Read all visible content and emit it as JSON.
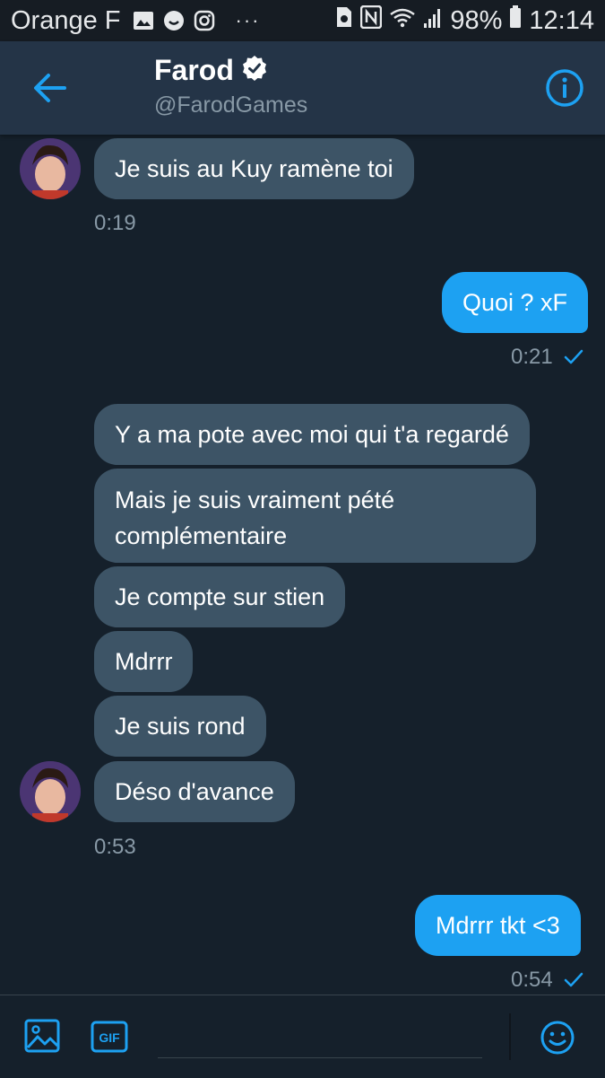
{
  "status_bar": {
    "carrier": "Orange F",
    "battery": "98%",
    "time": "12:14",
    "dots": "···",
    "icons": [
      "gallery-icon",
      "chat-icon",
      "instagram-icon",
      "sim-icon",
      "nfc-icon",
      "wifi-icon",
      "signal-icon",
      "battery-icon"
    ]
  },
  "header": {
    "name": "Farod",
    "handle": "@FarodGames",
    "verified": true,
    "accent": "#1da1f2"
  },
  "messages": [
    {
      "dir": "in",
      "text": "Je suis au Kuy ramène toi"
    },
    {
      "dir": "out",
      "text": "Quoi ? xF"
    },
    {
      "dir": "in",
      "text": "Y a ma pote avec moi qui t'a regardé"
    },
    {
      "dir": "in",
      "text": "Mais je suis vraiment pété complémentaire"
    },
    {
      "dir": "in",
      "text": "Je compte sur stien"
    },
    {
      "dir": "in",
      "text": "Mdrrr"
    },
    {
      "dir": "in",
      "text": "Je suis rond"
    },
    {
      "dir": "in",
      "text": "Déso d'avance"
    },
    {
      "dir": "out",
      "text": "Mdrrr tkt <3"
    }
  ],
  "timestamps": [
    "0:19",
    "0:21",
    "0:53",
    "0:54"
  ],
  "composer": {
    "gif_label": "GIF",
    "icons": [
      "image-icon",
      "gif-icon",
      "emoji-icon"
    ]
  },
  "colors": {
    "background": "#15202b",
    "header": "#243447",
    "incoming_bubble": "#3d5466",
    "outgoing_bubble": "#1da1f2"
  }
}
